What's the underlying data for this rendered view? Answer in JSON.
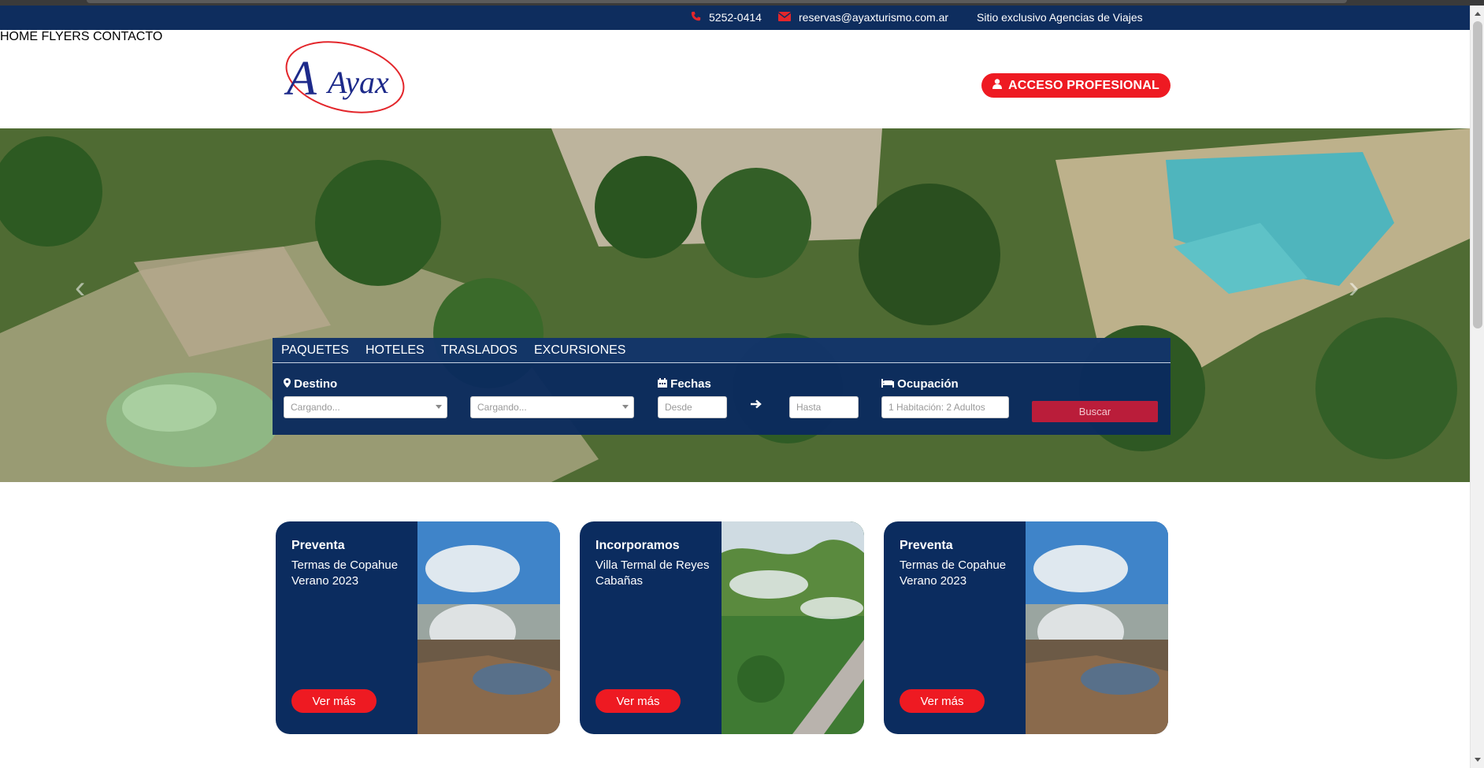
{
  "topbar": {
    "phone": "5252-0414",
    "phone_icon": "phone-icon",
    "email": "reservas@ayaxturismo.com.ar",
    "email_icon": "envelope-icon",
    "exclusive": "Sitio exclusivo Agencias de Viajes"
  },
  "header": {
    "logo_text": "Ayax",
    "nav": [
      "HOME",
      "FLYERS",
      "CONTACTO"
    ],
    "acceso_label": "ACCESO PROFESIONAL",
    "acceso_icon": "user-icon"
  },
  "hero": {
    "prev_arrow": "‹",
    "next_arrow": "›"
  },
  "search": {
    "tabs": [
      "PAQUETES",
      "HOTELES",
      "TRASLADOS",
      "EXCURSIONES"
    ],
    "destino_label": "Destino",
    "destino_icon": "map-marker-icon",
    "destino_origin_placeholder": "Cargando...",
    "destino_dest_placeholder": "Cargando...",
    "fechas_label": "Fechas",
    "fechas_icon": "calendar-icon",
    "desde_placeholder": "Desde",
    "hasta_placeholder": "Hasta",
    "ocupacion_label": "Ocupación",
    "ocupacion_icon": "bed-icon",
    "ocupacion_value": "1 Habitación: 2 Adultos",
    "buscar_label": "Buscar"
  },
  "cards": [
    {
      "title": "Preventa",
      "subtitle": "Termas de Copahue Verano 2023",
      "button": "Ver más"
    },
    {
      "title": "Incorporamos",
      "subtitle": "Villa Termal de Reyes Cabañas",
      "button": "Ver más"
    },
    {
      "title": "Preventa",
      "subtitle": "Termas de Copahue Verano 2023",
      "button": "Ver más"
    }
  ],
  "colors": {
    "navy": "#0e2d5e",
    "red": "#ee1a22",
    "buscar": "#ba1d3a"
  }
}
